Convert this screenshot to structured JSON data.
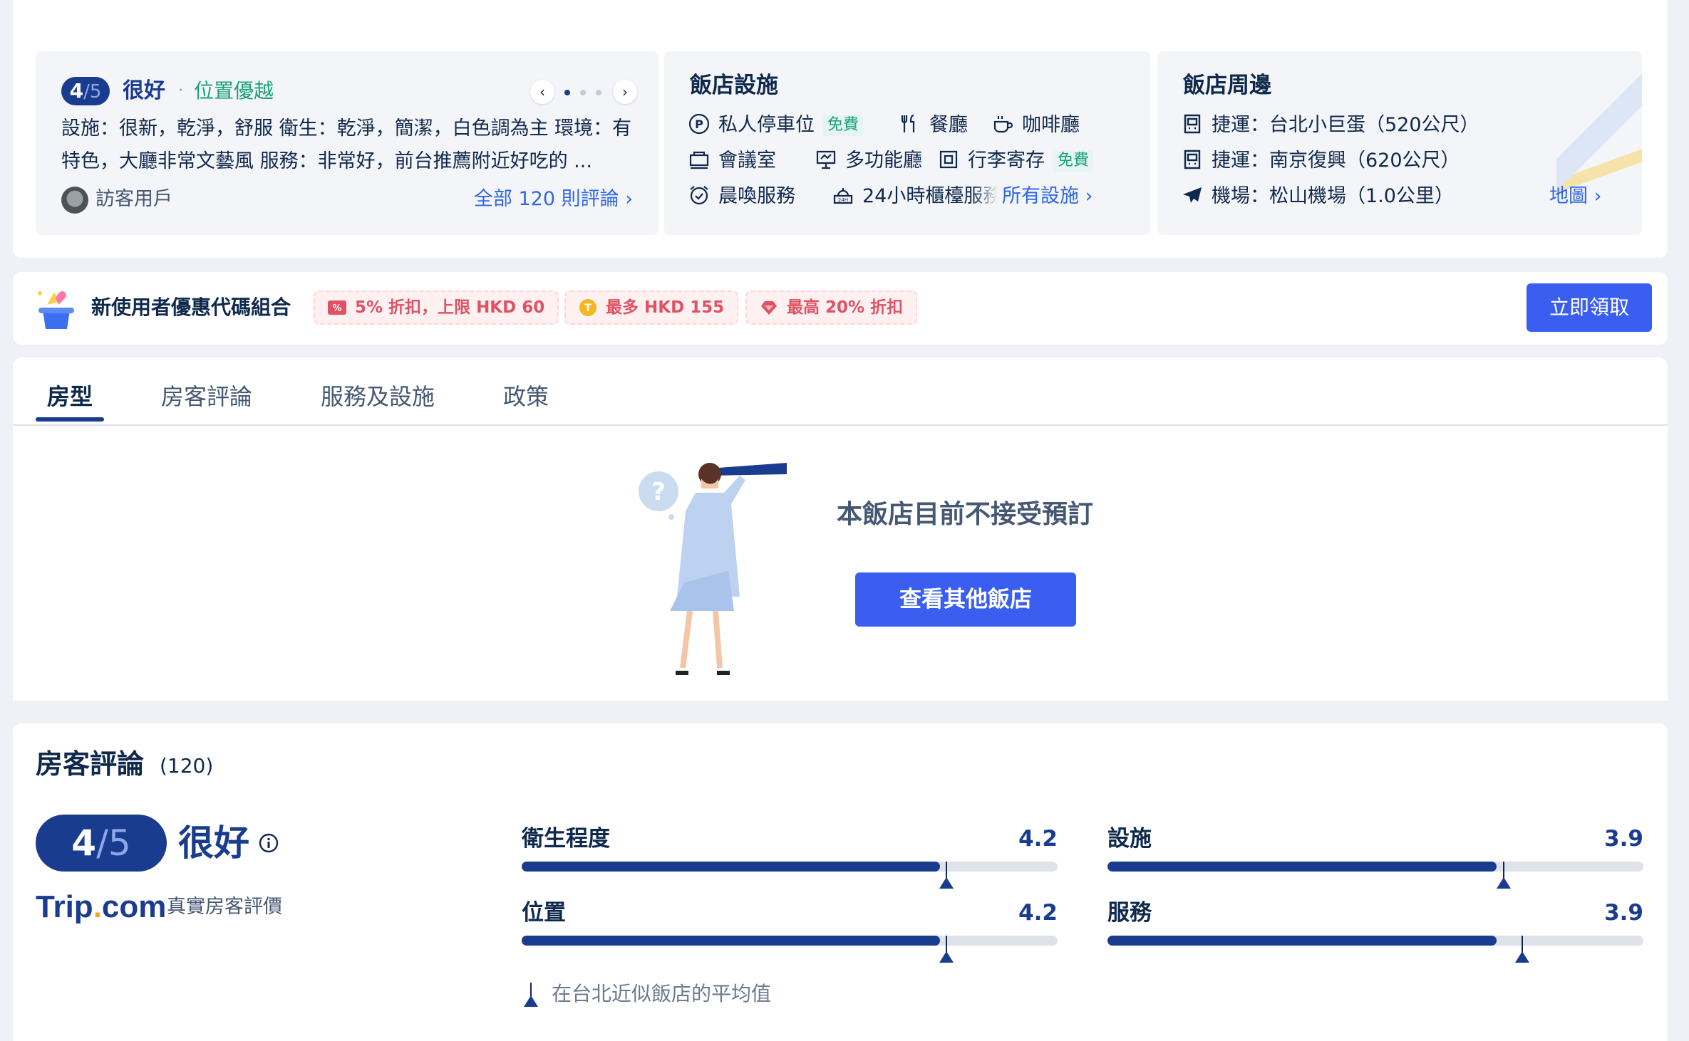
{
  "colors": {
    "brand": "#1a3c8f",
    "link": "#2f66e8",
    "primary_button": "#3a5ef0",
    "free_green": "#1aa27a",
    "coupon_red": "#e05263"
  },
  "review_snippet": {
    "score": "4",
    "score_denominator": "/5",
    "rating_word": "很好",
    "separator": "·",
    "tag": "位置優越",
    "text": "設施：很新，乾淨，舒服 衛生：乾淨，簡潔，白色調為主 環境：有特色，大廳非常文藝風 服務：非常好，前台推薦附近好吃的 ...",
    "user": "訪客用戶",
    "all_reviews_link": "全部 120 則評論",
    "carousel": {
      "prev_icon": "chevron-left-icon",
      "next_icon": "chevron-right-icon",
      "pages": 3,
      "active_page": 1
    }
  },
  "facilities": {
    "title": "飯店設施",
    "items": [
      {
        "icon": "parking-icon",
        "label": "私人停車位",
        "badge": "免費"
      },
      {
        "icon": "restaurant-icon",
        "label": "餐廳"
      },
      {
        "icon": "coffee-icon",
        "label": "咖啡廳"
      },
      {
        "icon": "meeting-room-icon",
        "label": "會議室"
      },
      {
        "icon": "multipurpose-hall-icon",
        "label": "多功能廳"
      },
      {
        "icon": "luggage-icon",
        "label": "行李寄存",
        "badge": "免費"
      },
      {
        "icon": "alarm-clock-icon",
        "label": "晨喚服務"
      },
      {
        "icon": "front-desk-24h-icon",
        "label": "24小時櫃檯服務"
      }
    ],
    "more_link": "所有設施"
  },
  "nearby": {
    "title": "飯店周邊",
    "items": [
      {
        "icon": "metro-icon",
        "label": "捷運：台北小巨蛋（520公尺）"
      },
      {
        "icon": "metro-icon",
        "label": "捷運：南京復興（620公尺）"
      },
      {
        "icon": "airplane-icon",
        "label": "機場：松山機場（1.0公里）"
      }
    ],
    "map_link": "地圖"
  },
  "promo": {
    "title": "新使用者優惠代碼組合",
    "coupons": [
      {
        "icon": "percent-ticket-icon",
        "label": "5% 折扣，上限 HKD 60"
      },
      {
        "icon": "trip-coin-icon",
        "label": "最多 HKD 155"
      },
      {
        "icon": "heart-gem-icon",
        "label": "最高 20% 折扣"
      }
    ],
    "claim_button": "立即領取"
  },
  "tabs": [
    {
      "label": "房型",
      "active": true
    },
    {
      "label": "房客評論",
      "active": false
    },
    {
      "label": "服務及設施",
      "active": false
    },
    {
      "label": "政策",
      "active": false
    }
  ],
  "booking": {
    "message": "本飯店目前不接受預訂",
    "button": "查看其他飯店"
  },
  "guest_reviews": {
    "title": "房客評論",
    "count": "(120)",
    "score": "4",
    "score_denominator": "/5",
    "rating_word": "很好",
    "brand": "Trip",
    "brand_dot": ".",
    "brand_suffix": "com",
    "verified_label": "真實房客評價",
    "sub_scores": [
      {
        "label": "衛生程度",
        "value": 4.2,
        "display": "4.2",
        "city_avg": 4.5
      },
      {
        "label": "設施",
        "value": 3.9,
        "display": "3.9",
        "city_avg": 4.2
      },
      {
        "label": "位置",
        "value": 4.2,
        "display": "4.2",
        "city_avg": 4.5
      },
      {
        "label": "服務",
        "value": 3.9,
        "display": "3.9",
        "city_avg": 4.4
      }
    ],
    "scale_max": 5,
    "legend": "在台北近似飯店的平均值"
  }
}
